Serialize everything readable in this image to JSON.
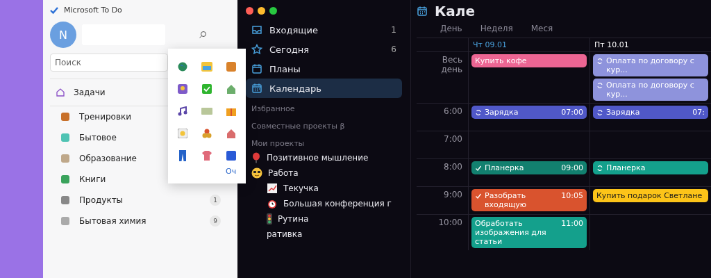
{
  "todo": {
    "title": "Microsoft To Do",
    "avatar": "N",
    "search": {
      "placeholder": "Поиск"
    },
    "nav": [
      {
        "label": "Задачи"
      }
    ],
    "lists": [
      {
        "label": "Тренировки"
      },
      {
        "label": "Бытовое"
      },
      {
        "label": "Образование"
      },
      {
        "label": "Книги"
      },
      {
        "label": "Продукты",
        "count": "1"
      },
      {
        "label": "Бытовая химия",
        "count": "9"
      }
    ]
  },
  "emoji_panel": {
    "link": "Оч"
  },
  "app": {
    "sidebar": {
      "nav": [
        {
          "label": "Входящие",
          "count": "1",
          "kind": "inbox",
          "selected": false
        },
        {
          "label": "Сегодня",
          "count": "6",
          "kind": "star",
          "selected": false
        },
        {
          "label": "Планы",
          "kind": "planner",
          "selected": false
        },
        {
          "label": "Календарь",
          "kind": "calendar",
          "selected": true
        }
      ],
      "sections": [
        {
          "title": "Избранное"
        },
        {
          "title": "Совместные проекты β"
        },
        {
          "title": "Мои проекты",
          "projects": [
            {
              "label": "Позитивное мышление",
              "kind": "balloon"
            },
            {
              "label": "Работа",
              "kind": "sunglasses",
              "children": [
                {
                  "label": "Текучка",
                  "kind": "chart"
                },
                {
                  "label": "Большая конференция г",
                  "kind": "alarm"
                },
                {
                  "label": "Рутина",
                  "kind": "traffic-light"
                },
                {
                  "label": "ративка"
                }
              ]
            }
          ]
        }
      ]
    },
    "calendar": {
      "title": "Кале",
      "views": [
        {
          "label": "День",
          "selected": false
        },
        {
          "label": "Неделя",
          "selected": false
        },
        {
          "label": "Меся",
          "selected": false
        }
      ],
      "days": [
        {
          "label": "Чт 09.01",
          "today": true
        },
        {
          "label": "Пт 10.01",
          "today": false
        }
      ],
      "all_day_label": "Весь день",
      "all_day": [
        [
          {
            "title": "Купить кофе",
            "color": "#ec6593",
            "recurring": false
          }
        ],
        [
          {
            "title": "Оплата по договору с кур...",
            "color": "#8e93dc",
            "recurring": true
          },
          {
            "title": "Оплата по договору с кур...",
            "color": "#8e93dc",
            "recurring": true
          }
        ]
      ],
      "hours": [
        {
          "time": "6:00",
          "cells": [
            [
              {
                "title": "Зарядка",
                "end": "07:00",
                "color": "#5058c8",
                "recurring": true,
                "done": false
              }
            ],
            [
              {
                "title": "Зарядка",
                "end": "07:",
                "color": "#5058c8",
                "recurring": true,
                "done": false
              }
            ]
          ]
        },
        {
          "time": "7:00",
          "cells": [
            [],
            []
          ]
        },
        {
          "time": "8:00",
          "cells": [
            [
              {
                "title": "Планерка",
                "end": "09:00",
                "color": "#12806f",
                "recurring": false,
                "done": true
              }
            ],
            [
              {
                "title": "Планерка",
                "color": "#14a08c",
                "recurring": true,
                "done": false
              }
            ]
          ]
        },
        {
          "time": "9:00",
          "cells": [
            [
              {
                "title": "Разобрать входящую",
                "end": "10:05",
                "color": "#d9532e",
                "recurring": false,
                "done": true
              }
            ],
            [
              {
                "title": "Купить подарок Светлане",
                "color": "#fcc419",
                "recurring": false,
                "done": false
              }
            ]
          ]
        },
        {
          "time": "10:00",
          "cells": [
            [
              {
                "title": "Обработать изображения для статьи",
                "end": "11:00",
                "color": "#14a08c",
                "recurring": false,
                "done": false
              }
            ],
            []
          ]
        }
      ]
    }
  }
}
